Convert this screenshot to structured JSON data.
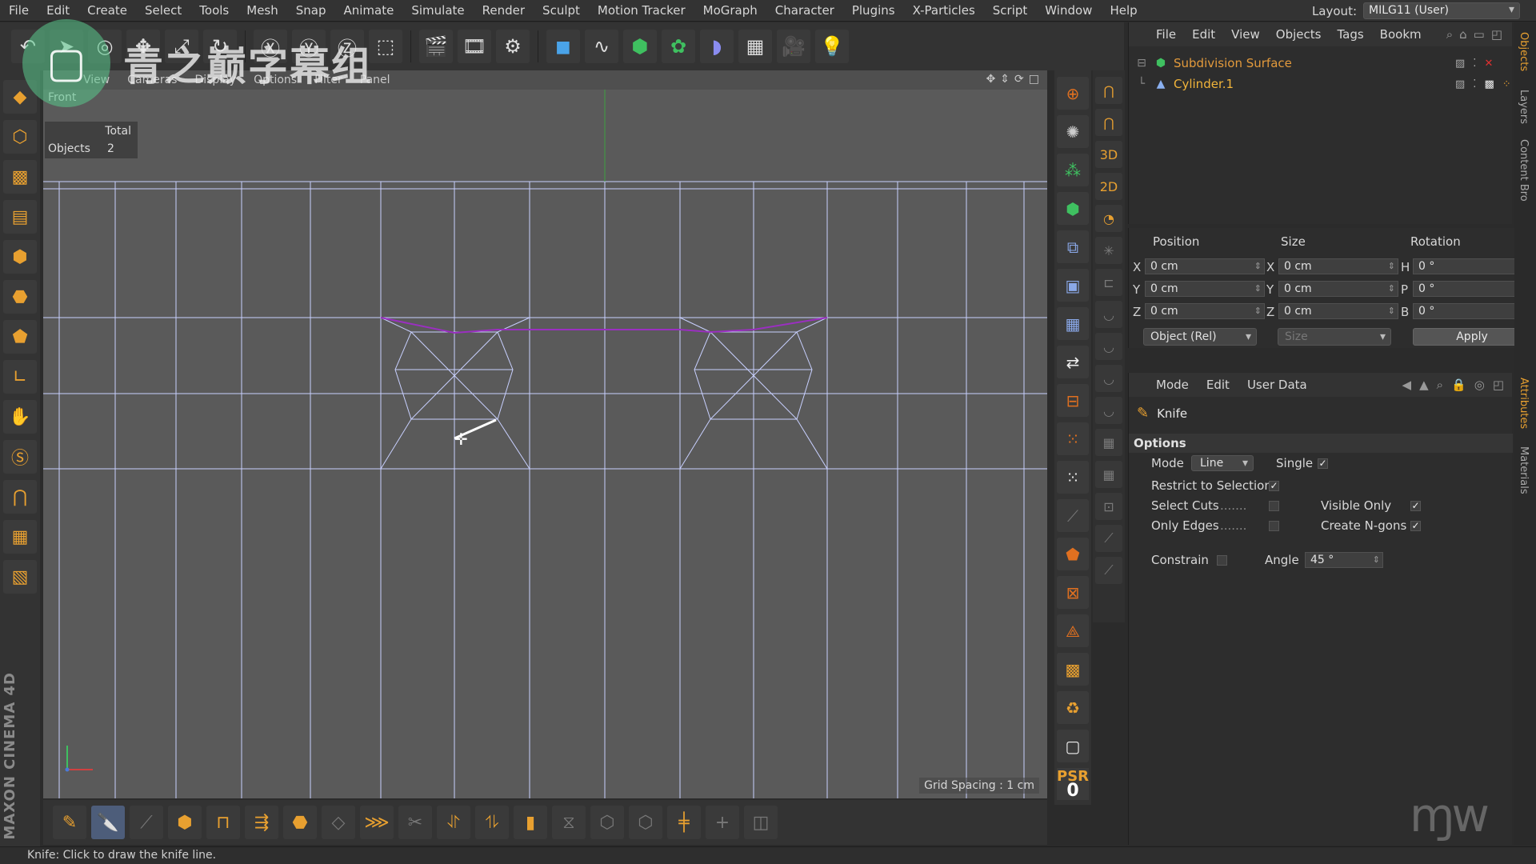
{
  "menubar": {
    "items": [
      "File",
      "Edit",
      "Create",
      "Select",
      "Tools",
      "Mesh",
      "Snap",
      "Animate",
      "Simulate",
      "Render",
      "Sculpt",
      "Motion Tracker",
      "MoGraph",
      "Character",
      "Plugins",
      "X-Particles",
      "Script",
      "Window",
      "Help"
    ],
    "layout_label": "Layout:",
    "layout_value": "MILG11 (User)"
  },
  "watermark": {
    "text": "青之巅字幕组"
  },
  "viewport": {
    "menu": [
      "View",
      "Cameras",
      "Display",
      "Options",
      "Filter",
      "Panel"
    ],
    "view_name": "Front",
    "hud": {
      "header": "Total",
      "label": "Objects",
      "value": "2"
    },
    "grid_spacing": "Grid Spacing : 1 cm"
  },
  "brand": "MAXON CINEMA 4D",
  "object_manager": {
    "menu": [
      "File",
      "Edit",
      "View",
      "Objects",
      "Tags",
      "Bookm"
    ],
    "objects": [
      {
        "name": "Subdivision Surface"
      },
      {
        "name": "Cylinder.1"
      }
    ]
  },
  "coordinates": {
    "headers": {
      "position": "Position",
      "size": "Size",
      "rotation": "Rotation"
    },
    "rows": [
      {
        "axis": "X",
        "position": "0 cm",
        "size_axis": "X",
        "size": "0 cm",
        "rot_axis": "H",
        "rotation": "0 °"
      },
      {
        "axis": "Y",
        "position": "0 cm",
        "size_axis": "Y",
        "size": "0 cm",
        "rot_axis": "P",
        "rotation": "0 °"
      },
      {
        "axis": "Z",
        "position": "0 cm",
        "size_axis": "Z",
        "size": "0 cm",
        "rot_axis": "B",
        "rotation": "0 °"
      }
    ],
    "mode_select": "Object (Rel)",
    "size_select": "Size",
    "apply": "Apply"
  },
  "attributes": {
    "menu": [
      "Mode",
      "Edit",
      "User Data"
    ],
    "tool_name": "Knife",
    "options_header": "Options",
    "mode_label": "Mode",
    "mode_value": "Line",
    "single_label": "Single",
    "single_checked": true,
    "restrict_label": "Restrict to Selection",
    "restrict_checked": true,
    "select_cuts_label": "Select Cuts",
    "select_cuts_checked": false,
    "visible_only_label": "Visible Only",
    "visible_only_checked": true,
    "only_edges_label": "Only Edges",
    "only_edges_checked": false,
    "create_ngons_label": "Create N-gons",
    "create_ngons_checked": true,
    "constrain_label": "Constrain",
    "constrain_checked": false,
    "angle_label": "Angle",
    "angle_value": "45 °"
  },
  "tab_strip": [
    "Objects",
    "Layers",
    "Content Bro",
    "Attributes",
    "Materials"
  ],
  "psr": {
    "label": "PSR",
    "value": "0"
  },
  "status": "Knife: Click to draw the knife line.",
  "colors": {
    "accent_orange": "#e8a030",
    "object_name": "#e39a3c",
    "viewport_bg": "#5a5a5a",
    "grid_line": "#c8d0ff",
    "knife_selection": "#9a2fc0"
  }
}
